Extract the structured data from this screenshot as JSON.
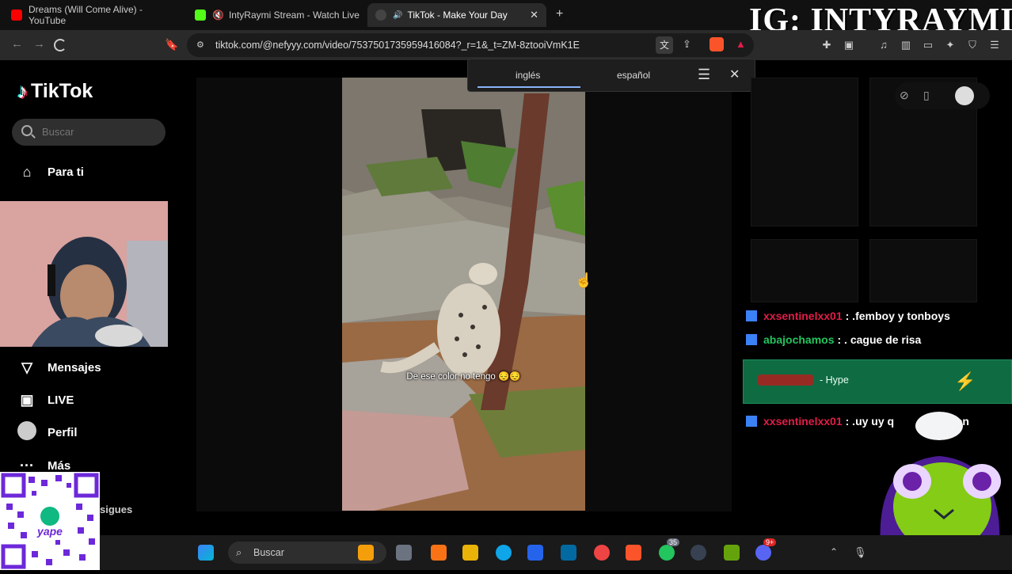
{
  "browser": {
    "tabs": [
      {
        "title": "Dreams (Will Come Alive) - YouTube",
        "icon": "youtube-icon",
        "color": "#ff0000"
      },
      {
        "title": "IntyRaymi Stream - Watch Live or",
        "icon": "kick-icon",
        "color": "#53fc18"
      },
      {
        "title": "TikTok - Make Your Day",
        "icon": "tiktok-icon",
        "color": "#ffffff"
      }
    ],
    "url": "tiktok.com/@nefyyy.com/video/7537501735959416084?_r=1&_t=ZM-8ztooiVmK1E"
  },
  "overlay": {
    "ig_handle": "IG: INTYRAYMI"
  },
  "translate_popup": {
    "source_lang": "inglés",
    "target_lang": "español"
  },
  "tiktok": {
    "logo": "TikTok",
    "search_placeholder": "Buscar",
    "nav": [
      {
        "label": "Para ti",
        "icon": "home-icon"
      },
      {
        "label": "Mensajes",
        "icon": "send-icon"
      },
      {
        "label": "LIVE",
        "icon": "live-icon"
      },
      {
        "label": "Perfil",
        "icon": "profile-avatar-icon"
      },
      {
        "label": "Más",
        "icon": "more-icon"
      }
    ],
    "following_partial": "sigues",
    "video_subtitle": "De ese color no tengo 😔😔"
  },
  "chat": {
    "messages": [
      {
        "user": "xxsentinelxx01",
        "text": ": .femboy y tonboys",
        "user_color": "#e11d48"
      },
      {
        "user": "abajochamos",
        "text": ": . cague de risa",
        "user_color": "#22c55e"
      },
      {
        "user": "xxsentinelxx01",
        "text": ": .uy uy q",
        "user_color": "#e11d48"
      }
    ],
    "hype_label": "- Hype",
    "peron_partial": "peron"
  },
  "taskbar": {
    "search_placeholder": "Buscar",
    "badge_count": "35",
    "badge_count2": "9+"
  }
}
